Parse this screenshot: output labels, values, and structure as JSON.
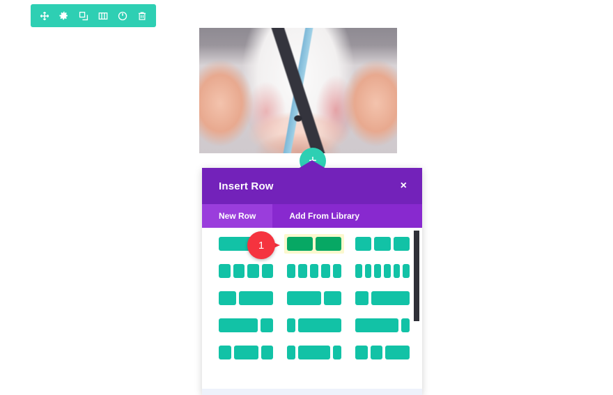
{
  "colors": {
    "toolbar_teal": "#2ecfb3",
    "modal_purple": "#7322ba",
    "tab_bar_purple": "#8829cf",
    "tab_active_purple": "#9a3ddc",
    "column_teal": "#12c2a6",
    "column_highlight_green": "#07a864",
    "highlight_background": "#fbf8cd",
    "marker_red": "#f5333f",
    "page_background": "#ffffff"
  },
  "module_toolbar": {
    "buttons": [
      {
        "name": "move-icon",
        "label": "Move"
      },
      {
        "name": "gear-icon",
        "label": "Settings"
      },
      {
        "name": "duplicate-icon",
        "label": "Duplicate"
      },
      {
        "name": "columns-icon",
        "label": "Columns"
      },
      {
        "name": "power-icon",
        "label": "Disable"
      },
      {
        "name": "trash-icon",
        "label": "Delete"
      }
    ]
  },
  "content": {
    "image_alt": "Child's cupped hands holding a small blue and black quadcopter drone"
  },
  "add_row_button": {
    "label": "+"
  },
  "modal": {
    "title": "Insert Row",
    "close_label": "×",
    "tabs": [
      {
        "label": "New Row",
        "active": true
      },
      {
        "label": "Add From Library",
        "active": false
      }
    ],
    "layout_rows": [
      [
        {
          "columns": [
            12
          ],
          "highlighted": false
        },
        {
          "columns": [
            6,
            6
          ],
          "highlighted": true
        },
        {
          "columns": [
            4,
            4,
            4
          ],
          "highlighted": false
        }
      ],
      [
        {
          "columns": [
            3,
            3,
            3,
            3
          ],
          "highlighted": false
        },
        {
          "columns": [
            2.4,
            2.4,
            2.4,
            2.4,
            2.4
          ],
          "highlighted": false
        },
        {
          "columns": [
            2,
            2,
            2,
            2,
            2,
            2
          ],
          "highlighted": false
        }
      ],
      [
        {
          "columns": [
            4,
            8
          ],
          "highlighted": false
        },
        {
          "columns": [
            8,
            4
          ],
          "highlighted": false
        },
        {
          "columns": [
            3,
            9
          ],
          "highlighted": false
        }
      ],
      [
        {
          "columns": [
            9,
            3
          ],
          "highlighted": false
        },
        {
          "columns": [
            2,
            10
          ],
          "highlighted": false
        },
        {
          "columns": [
            10,
            2
          ],
          "highlighted": false
        }
      ],
      [
        {
          "columns": [
            3,
            6,
            3
          ],
          "highlighted": false
        },
        {
          "columns": [
            2,
            8,
            2
          ],
          "highlighted": false
        },
        {
          "columns": [
            3,
            3,
            6
          ],
          "highlighted": false
        }
      ]
    ]
  },
  "markers": [
    {
      "number": "1"
    }
  ]
}
